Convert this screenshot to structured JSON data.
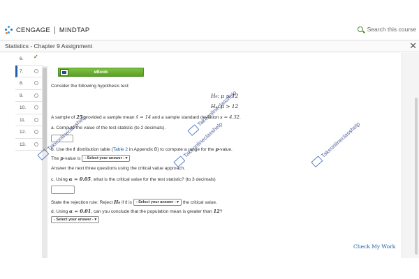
{
  "brand": {
    "name": "CENGAGE",
    "product": "MINDTAP"
  },
  "search": {
    "placeholder": "Search this course",
    "icon": "search-icon"
  },
  "assignment": {
    "title": "Statistics - Chapter 9 Assignment"
  },
  "nav": {
    "items": [
      {
        "num": "6.",
        "status": "done"
      },
      {
        "num": "7.",
        "status": "active"
      },
      {
        "num": "8.",
        "status": "open"
      },
      {
        "num": "9.",
        "status": "open"
      },
      {
        "num": "10.",
        "status": "open"
      },
      {
        "num": "11.",
        "status": "open"
      },
      {
        "num": "12.",
        "status": "open"
      },
      {
        "num": "13.",
        "status": "open"
      }
    ]
  },
  "question": {
    "ebook_label": "eBook",
    "intro": "Consider the following hypothesis test:",
    "h0": "H₀: μ ≤ 12",
    "ha": "Hₐ: μ > 12",
    "sample_pre": "A sample of ",
    "sample_n": "25",
    "sample_mid": " provided a sample mean ",
    "sample_mean": "x̄ = 14",
    "sample_mid2": " and a sample standard deviation ",
    "sample_sd": "s = 4.32",
    "sample_end": ".",
    "part_a": "a. Compute the value of the test statistic (to 2 decimals).",
    "part_b_pre": "b. Use the ",
    "part_b_t": "t",
    "part_b_mid": " distribution table (",
    "part_b_link": "Table 2",
    "part_b_end": " in Appendix B) to compute a range for the ",
    "part_b_p": "p",
    "part_b_end2": "-value.",
    "pvalue_pre": "The ",
    "pvalue_p": "p",
    "pvalue_post": "-value is",
    "select_placeholder": "- Select your answer -",
    "answer_next": "Answer the next three questions using the critical value approach.",
    "part_c_pre": "c. Using ",
    "part_c_alpha": "α = 0.05",
    "part_c_post": ", what is the critical value for the test statistic? (to 3 decimals)",
    "reject_pre": "State the rejection rule: Reject ",
    "reject_h0": "H₀",
    "reject_mid": " if ",
    "reject_t": "t",
    "reject_is": " is",
    "reject_post": " the critical value.",
    "part_d_pre": "d. Using ",
    "part_d_alpha": "α = 0.01",
    "part_d_post": ", can you conclude that the population mean is greater than ",
    "part_d_num": "12",
    "part_d_end": "?"
  },
  "check_my_work": "Check My Work",
  "watermarks": [
    "Takeonlineclasshelp",
    "Takeonlineclasshelp",
    "Takeonlineclasshelp",
    "Takeonlineclasshelp"
  ]
}
